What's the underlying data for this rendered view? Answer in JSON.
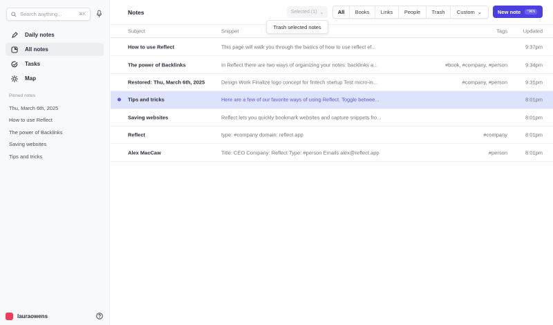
{
  "sidebar": {
    "search_placeholder": "Search anything...",
    "search_shortcut": "⌘K",
    "nav": [
      {
        "label": "Daily notes",
        "icon": "pencil-icon"
      },
      {
        "label": "All notes",
        "icon": "notes-icon"
      },
      {
        "label": "Tasks",
        "icon": "check-circle-icon"
      },
      {
        "label": "Map",
        "icon": "sun-icon"
      }
    ],
    "pinned_heading": "Pinned notes",
    "pinned": [
      "Thu, March 6th, 2025",
      "How to use Reflect",
      "The power of Backlinks",
      "Saving websites",
      "Tips and tricks"
    ],
    "user": "lauraowens"
  },
  "header": {
    "title": "Notes",
    "selected": "Selected (1)",
    "filters": [
      "All",
      "Books",
      "Links",
      "People",
      "Trash",
      "Custom"
    ],
    "new_note": "New note",
    "new_note_shortcut": "^⌘N",
    "tooltip": "Trash selected notes"
  },
  "table": {
    "columns": {
      "subject": "Subject",
      "snippet": "Snippet",
      "tags": "Tags",
      "updated": "Updated"
    },
    "rows": [
      {
        "subject": "How to use Reflect",
        "snippet": "This page will walk you through the basics of how to use reflect ef...",
        "tags": "",
        "updated": "9:37pm"
      },
      {
        "subject": "The power of Backlinks",
        "snippet": "In Reflect there are two ways of organizing your notes: backlinks a...",
        "tags": "#book, #company, #person",
        "updated": "9:34pm"
      },
      {
        "subject": "Restored: Thu, March 6th, 2025",
        "snippet": "Design Work Finalize logo concept for fintech startup Test micro-in...",
        "tags": "#company, #person",
        "updated": "9:31pm"
      },
      {
        "subject": "Tips and tricks",
        "snippet": "Here are a few of our favorite ways of using Reflect. Toggle betwee...",
        "tags": "",
        "updated": "8:01pm",
        "selected": true
      },
      {
        "subject": "Saving websites",
        "snippet": "Reflect lets you quickly bookmark websites and capture snippets fro...",
        "tags": "",
        "updated": "8:01pm"
      },
      {
        "subject": "Reflect",
        "snippet": "type: #company domain: reflect.app",
        "tags": "#company",
        "updated": "8:01pm"
      },
      {
        "subject": "Alex MacCaw",
        "snippet": "Title: CEO Company: Reflect Type: #person Emails alex@reflect.app",
        "tags": "#person",
        "updated": "8:01pm"
      }
    ]
  },
  "colors": {
    "accent": "#4b3fe0",
    "selected_row": "#dde3fc",
    "avatar": "#f03c5a"
  }
}
